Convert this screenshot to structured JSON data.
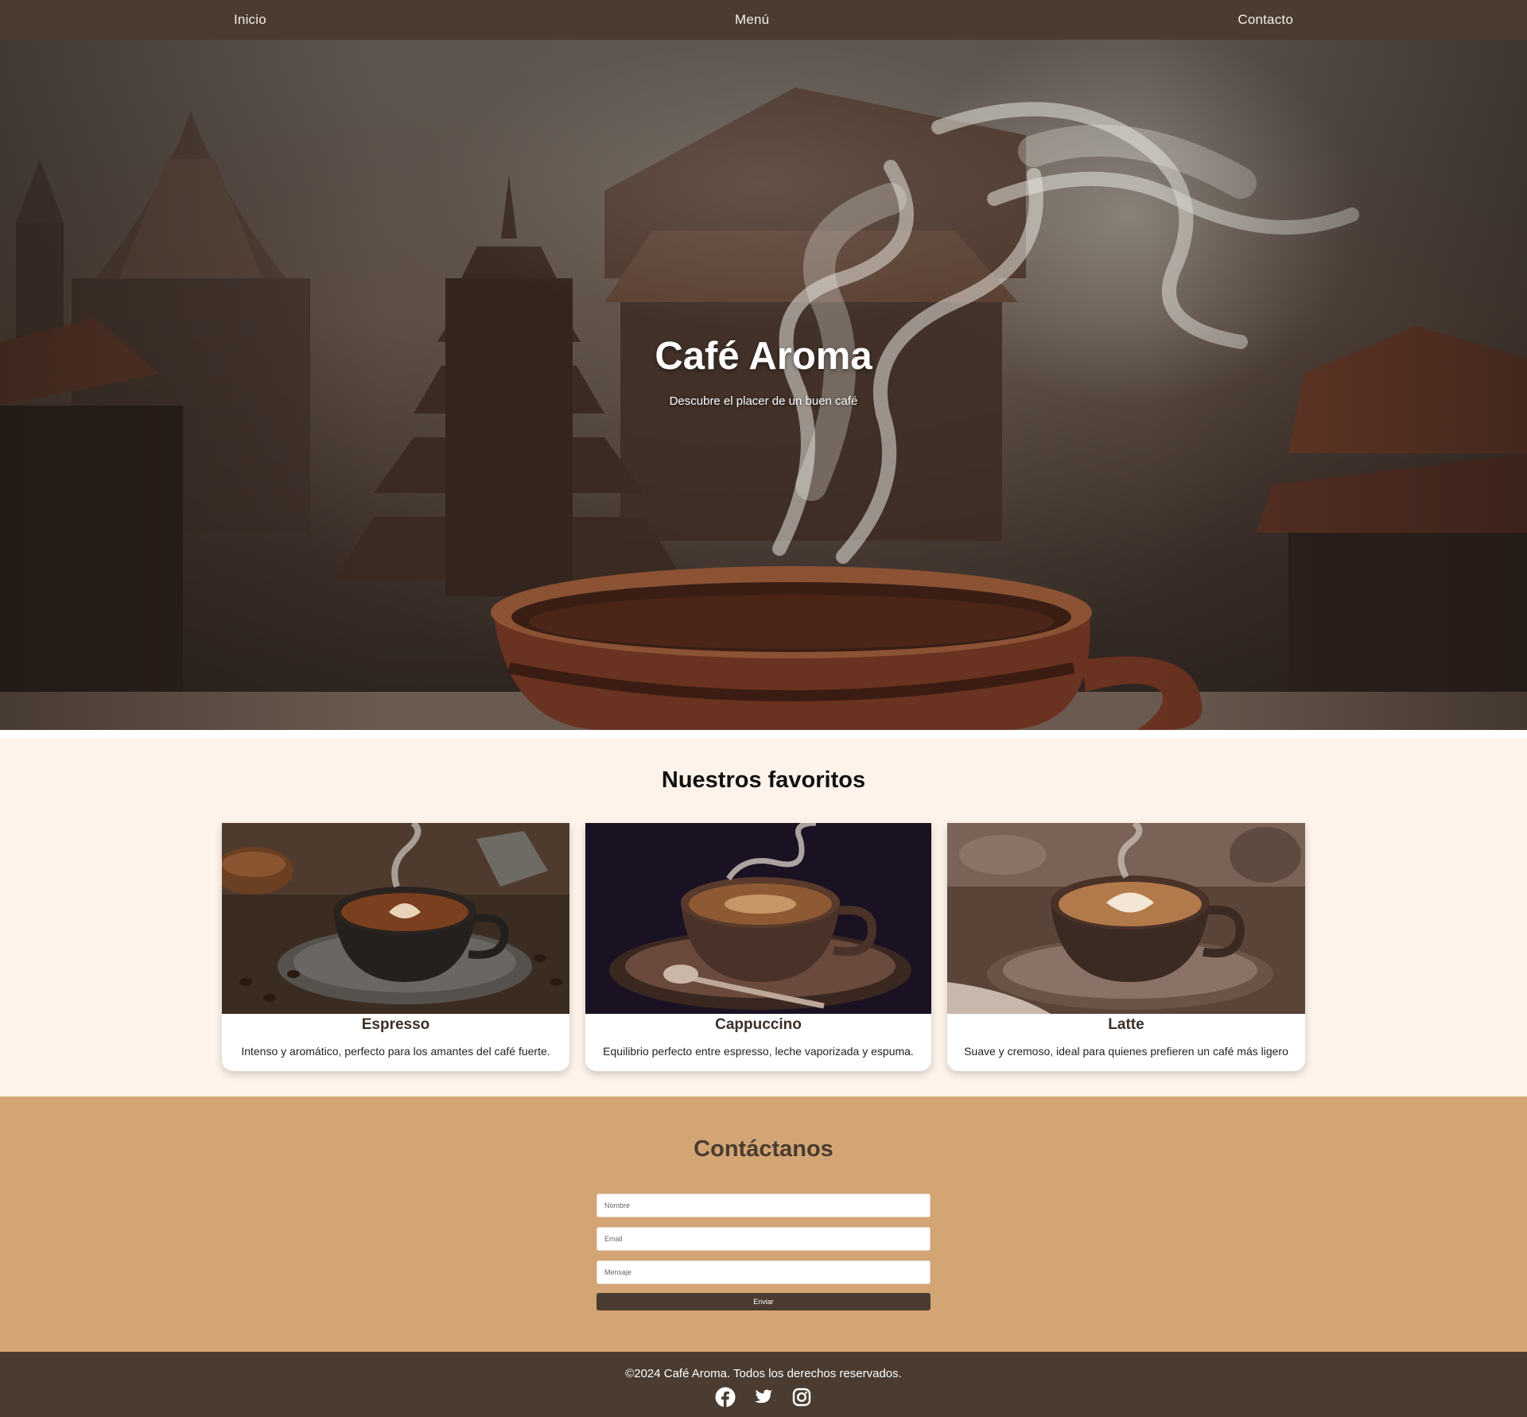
{
  "nav": {
    "items": [
      {
        "label": "Inicio"
      },
      {
        "label": "Menú"
      },
      {
        "label": "Contacto"
      }
    ]
  },
  "hero": {
    "title": "Café Aroma",
    "subtitle": "Descubre el placer de un buen café"
  },
  "favorites": {
    "title": "Nuestros favoritos",
    "items": [
      {
        "name": "Espresso",
        "description": "Intenso y aromático, perfecto para los amantes del café fuerte."
      },
      {
        "name": "Cappuccino",
        "description": "Equilibrio perfecto entre espresso, leche vaporizada y espuma."
      },
      {
        "name": "Latte",
        "description": "Suave y cremoso, ideal para quienes prefieren un café más ligero"
      }
    ]
  },
  "contact": {
    "title": "Contáctanos",
    "name_placeholder": "Nombre",
    "email_placeholder": "Email",
    "message_placeholder": "Mensaje",
    "submit_label": "Enviar"
  },
  "footer": {
    "copyright": "©2024 Café Aroma. Todos los derechos reservados.",
    "social_icons": [
      "facebook-icon",
      "twitter-icon",
      "instagram-icon"
    ]
  },
  "colors": {
    "nav_bg": "#4a3c31",
    "favorites_bg": "#fdf3ea",
    "contact_bg": "#d4a574",
    "footer_bg": "#4a3c31"
  }
}
